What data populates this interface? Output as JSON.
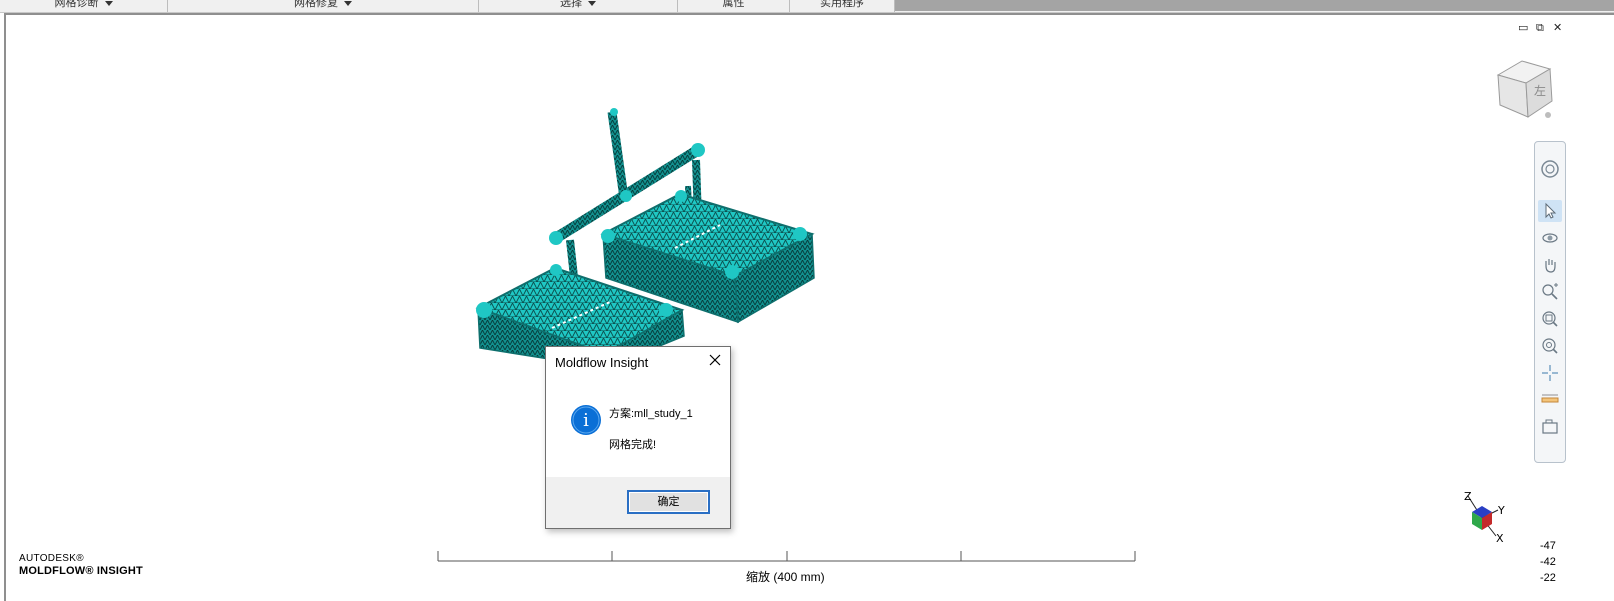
{
  "ribbon": {
    "groups": [
      {
        "label": "网格诊断",
        "has_dropdown": true
      },
      {
        "label": "网格修复",
        "has_dropdown": true
      },
      {
        "label": "选择",
        "has_dropdown": true
      },
      {
        "label": "属性",
        "has_dropdown": false
      },
      {
        "label": "实用程序",
        "has_dropdown": false
      }
    ]
  },
  "window_controls": {
    "minimize": "▭",
    "restore": "⧉",
    "close": "✕"
  },
  "viewcube": {
    "face_label": "左"
  },
  "navbar": {
    "tools": [
      {
        "name": "steering-wheel-icon",
        "active": false
      },
      {
        "name": "select-icon",
        "active": true
      },
      {
        "name": "orbit-icon",
        "active": false
      },
      {
        "name": "pan-icon",
        "active": false
      },
      {
        "name": "zoom-icon",
        "active": false
      },
      {
        "name": "zoom-window-icon",
        "active": false
      },
      {
        "name": "zoom-extents-icon",
        "active": false
      },
      {
        "name": "center-icon",
        "active": false
      },
      {
        "name": "measure-icon",
        "active": false
      },
      {
        "name": "camera-icon",
        "active": false
      }
    ]
  },
  "dialog": {
    "title": "Moldflow Insight",
    "line1": "方案:mll_study_1",
    "line2": "网格完成!",
    "ok_label": "确定",
    "info_glyph": "i"
  },
  "scale": {
    "label": "缩放 (400 mm)"
  },
  "branding": {
    "line1": "AUTODESK®",
    "line2": "MOLDFLOW® INSIGHT"
  },
  "triad": {
    "x": "X",
    "y": "Y",
    "z": "Z"
  },
  "legend_values": [
    "-47",
    "-42",
    "-22"
  ],
  "colors": {
    "mesh": "#1fc7c4",
    "mesh_dark": "#0b5f5d",
    "accent_button": "#2a6fc4",
    "info_icon": "#0a6fd6"
  }
}
